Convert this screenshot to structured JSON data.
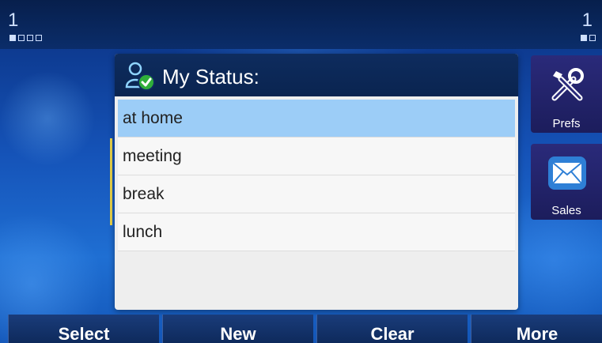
{
  "status_bar": {
    "line_left": "1",
    "line_right": "1"
  },
  "dialog": {
    "title": "My Status:",
    "items": [
      {
        "label": "at home",
        "selected": true
      },
      {
        "label": "meeting",
        "selected": false
      },
      {
        "label": "break",
        "selected": false
      },
      {
        "label": "lunch",
        "selected": false
      }
    ]
  },
  "apps": {
    "prefs_label": "Prefs",
    "sales_label": "Sales"
  },
  "softkeys": {
    "select": "Select",
    "new": "New",
    "clear": "Clear",
    "more": "More"
  },
  "colors": {
    "selection": "#9ccdf7",
    "marker": "#e8d24a",
    "header": "#0e2c5e"
  }
}
